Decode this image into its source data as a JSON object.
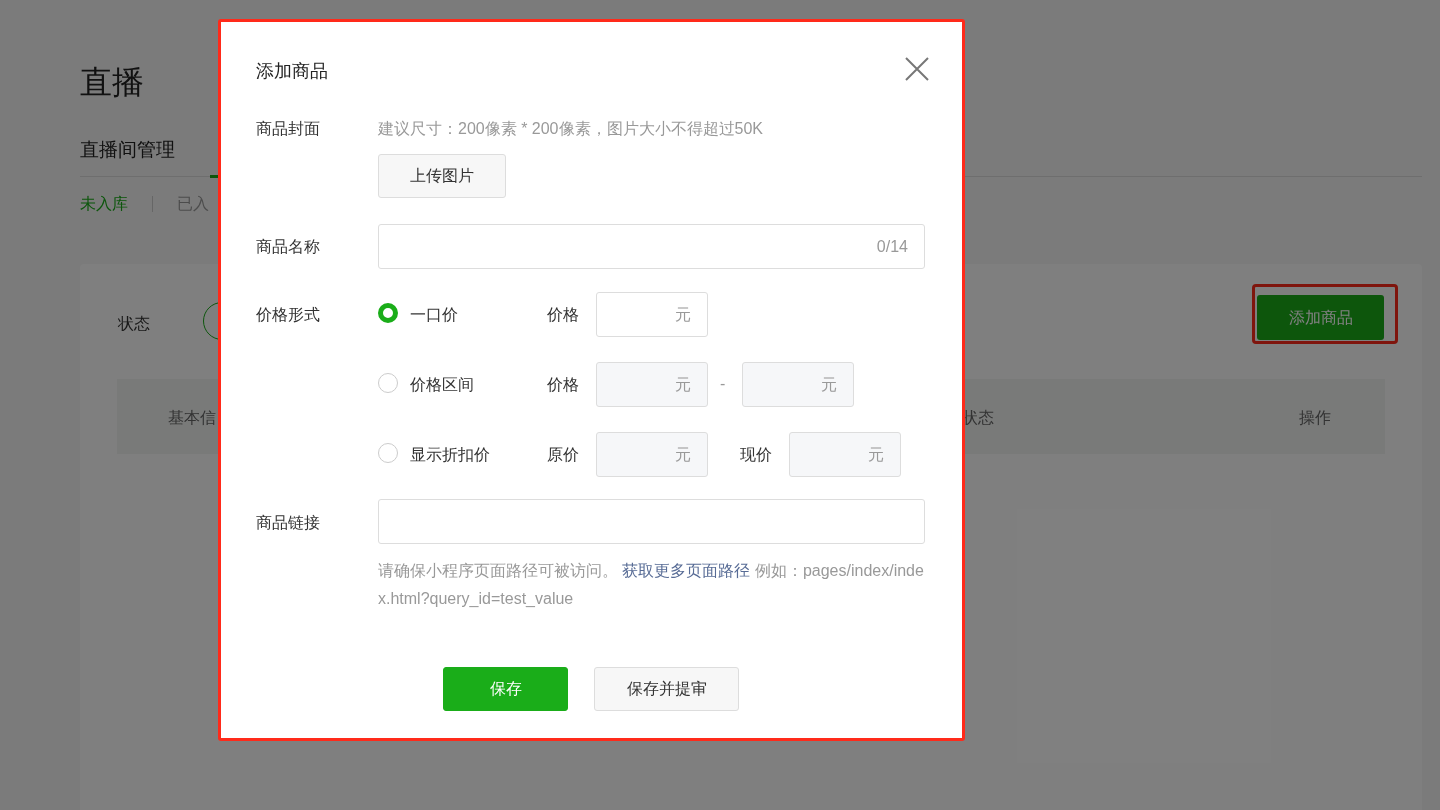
{
  "page": {
    "title": "直播",
    "tabs": [
      {
        "label": "直播间管理",
        "selected": false
      }
    ],
    "subtabs": [
      {
        "label": "未入库",
        "selected": true
      },
      {
        "label": "已入",
        "selected": false
      }
    ],
    "filter_label": "状态",
    "add_button": "添加商品",
    "table_columns": [
      "基本信",
      "状态",
      "操作"
    ]
  },
  "dialog": {
    "title": "添加商品",
    "cover": {
      "label": "商品封面",
      "hint": "建议尺寸：200像素 * 200像素，图片大小不得超过50K",
      "button": "上传图片"
    },
    "name": {
      "label": "商品名称",
      "counter": "0/14"
    },
    "price": {
      "label": "价格形式",
      "options": [
        {
          "label": "一口价",
          "selected": true,
          "fields": [
            {
              "label": "价格",
              "unit": "元"
            }
          ]
        },
        {
          "label": "价格区间",
          "selected": false,
          "fields": [
            {
              "label": "价格",
              "unit": "元"
            },
            {
              "separator": "-",
              "unit": "元"
            }
          ]
        },
        {
          "label": "显示折扣价",
          "selected": false,
          "fields": [
            {
              "label": "原价",
              "unit": "元"
            },
            {
              "label": "现价",
              "unit": "元"
            }
          ]
        }
      ]
    },
    "link": {
      "label": "商品链接",
      "note_before": "请确保小程序页面路径可被访问。",
      "note_link": "获取更多页面路径",
      "note_after": "例如：pages/index/index.html?query_id=test_value"
    },
    "buttons": [
      {
        "label": "保存",
        "kind": "primary"
      },
      {
        "label": "保存并提审",
        "kind": "secondary"
      }
    ]
  }
}
